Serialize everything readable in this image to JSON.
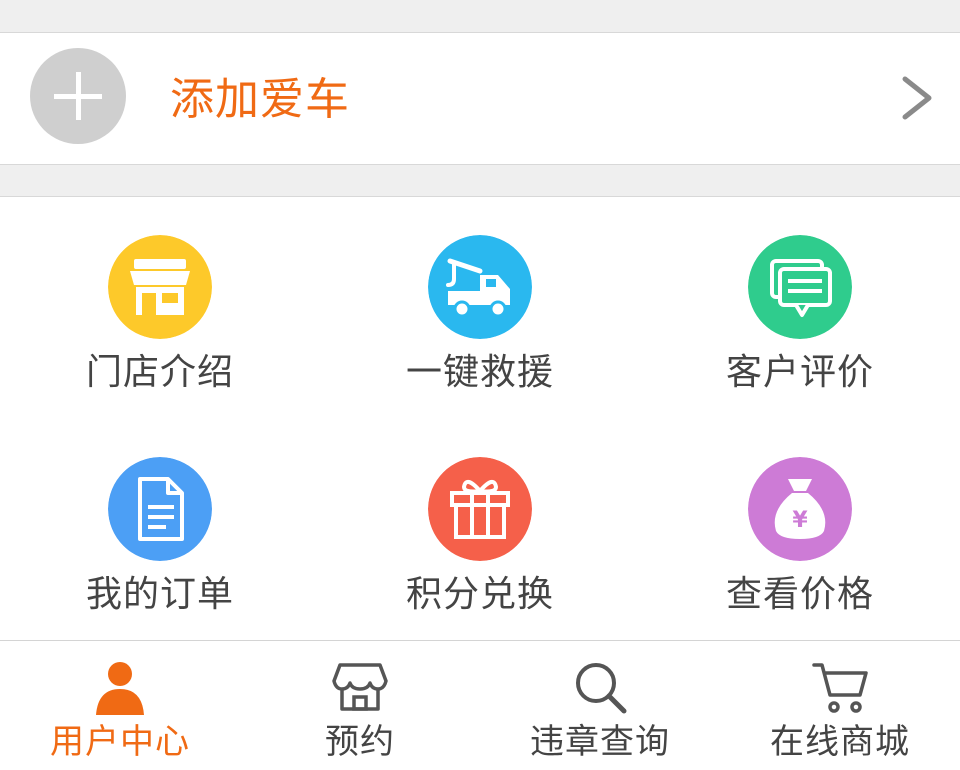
{
  "add_car": {
    "label": "添加爱车",
    "icon": "plus-icon",
    "chevron": "chevron-right-icon"
  },
  "grid": {
    "items": [
      {
        "label": "门店介绍",
        "icon": "store-icon",
        "color": "#fdc92a"
      },
      {
        "label": "一键救援",
        "icon": "tow-truck-icon",
        "color": "#2ab8ef"
      },
      {
        "label": "客户评价",
        "icon": "chat-bubbles-icon",
        "color": "#2fcc8d"
      },
      {
        "label": "我的订单",
        "icon": "document-icon",
        "color": "#4c9ff5"
      },
      {
        "label": "积分兑换",
        "icon": "gift-icon",
        "color": "#f5604a"
      },
      {
        "label": "查看价格",
        "icon": "money-bag-icon",
        "color": "#cd7bd6"
      }
    ]
  },
  "tabbar": {
    "active_color": "#f06a14",
    "tabs": [
      {
        "label": "用户中心",
        "icon": "user-icon",
        "active": true
      },
      {
        "label": "预约",
        "icon": "shop-icon",
        "active": false
      },
      {
        "label": "违章查询",
        "icon": "search-icon",
        "active": false
      },
      {
        "label": "在线商城",
        "icon": "cart-icon",
        "active": false
      }
    ]
  }
}
